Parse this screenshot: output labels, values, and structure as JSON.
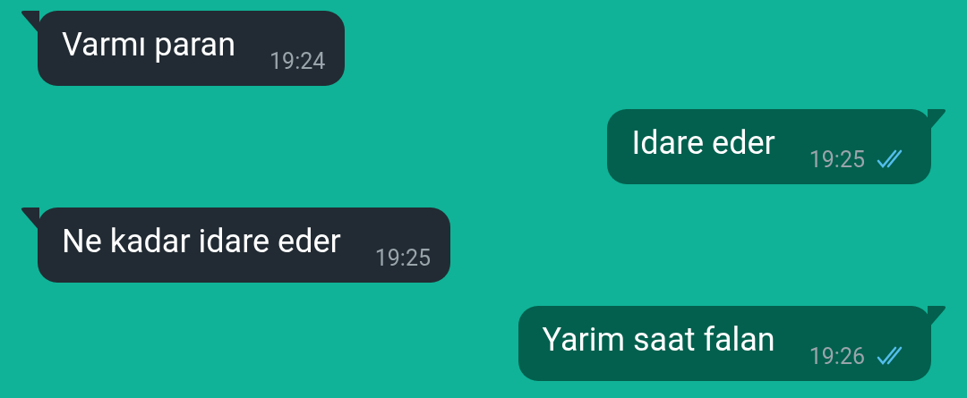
{
  "messages": [
    {
      "kind": "incoming",
      "text": "Varmı paran",
      "time": "19:24"
    },
    {
      "kind": "outgoing",
      "text": "Idare eder",
      "time": "19:25",
      "read": true
    },
    {
      "kind": "incoming",
      "text": "Ne kadar idare eder",
      "time": "19:25"
    },
    {
      "kind": "outgoing",
      "text": "Yarim saat falan",
      "time": "19:26",
      "read": true
    }
  ]
}
